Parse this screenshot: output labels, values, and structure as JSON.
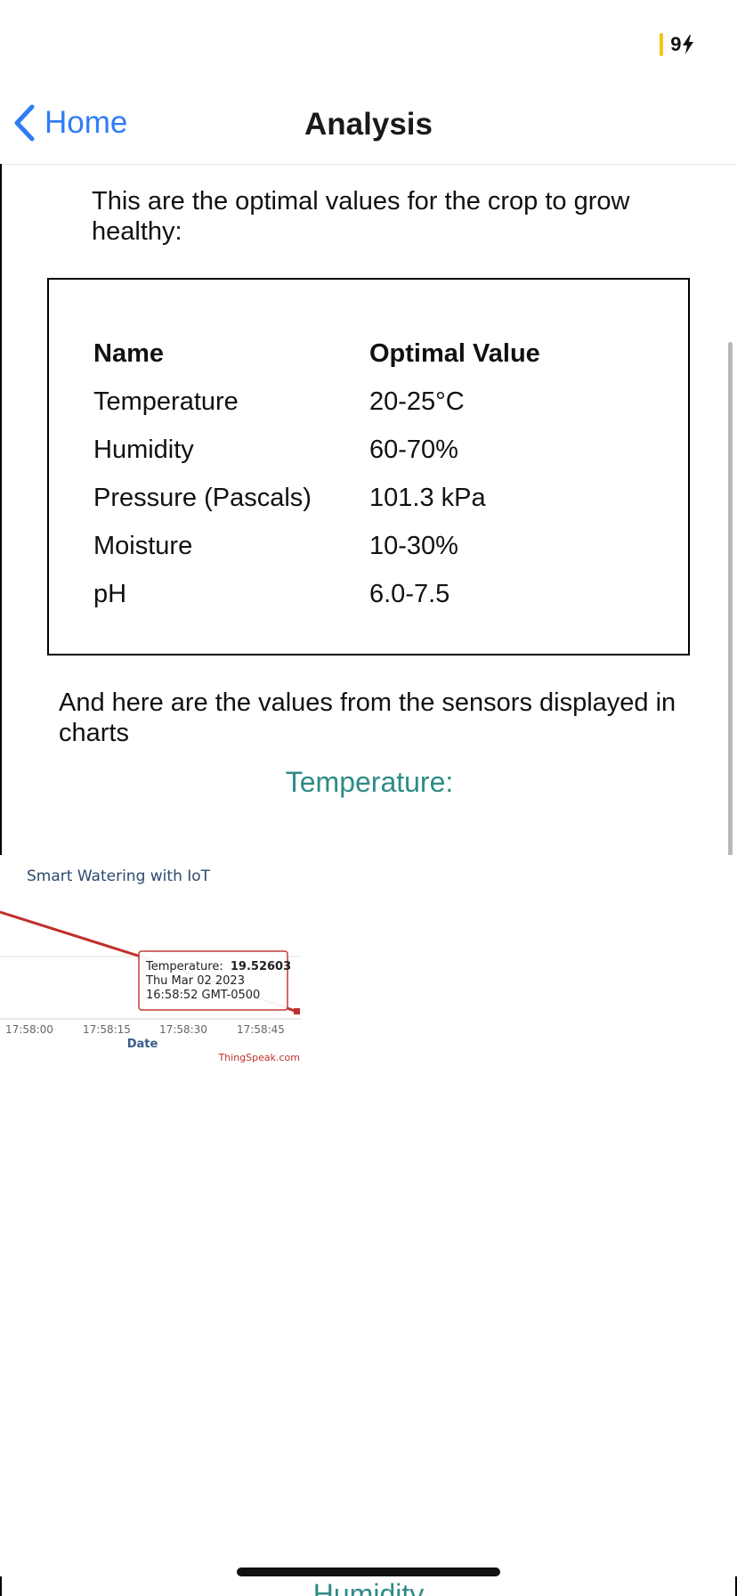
{
  "status_bar": {
    "battery_text": "9",
    "battery_color": "#f5c518"
  },
  "nav": {
    "back_label": "Home",
    "title": "Analysis",
    "accent_color": "#2f7cf6",
    "back_icon": "chevron-left-icon"
  },
  "content": {
    "intro": "This are the optimal values for the crop to grow healthy:",
    "table": {
      "headers": [
        "Name",
        "Optimal Value"
      ],
      "rows": [
        {
          "name": "Temperature",
          "value": "20-25°C"
        },
        {
          "name": "Humidity",
          "value": "60-70%"
        },
        {
          "name": "Pressure (Pascals)",
          "value": "101.3 kPa"
        },
        {
          "name": "Moisture",
          "value": "10-30%"
        },
        {
          "name": "pH",
          "value": "6.0-7.5"
        }
      ]
    },
    "sensors_text": "And here are the values from the sensors displayed in charts",
    "temperature_heading": "Temperature:",
    "heading_color": "#2e8b87",
    "next_heading_fragment": "Humidity"
  },
  "chart": {
    "title": "Smart Watering with IoT",
    "xlabel": "Date",
    "x_ticks": [
      "17:58:00",
      "17:58:15",
      "17:58:30",
      "17:58:45"
    ],
    "credit": "ThingSpeak.com",
    "series_color": "#c0302c",
    "tooltip": {
      "label": "Temperature:",
      "value": "19.52603",
      "date": "Thu Mar 02 2023",
      "time": "16:58:52 GMT-0500"
    }
  }
}
